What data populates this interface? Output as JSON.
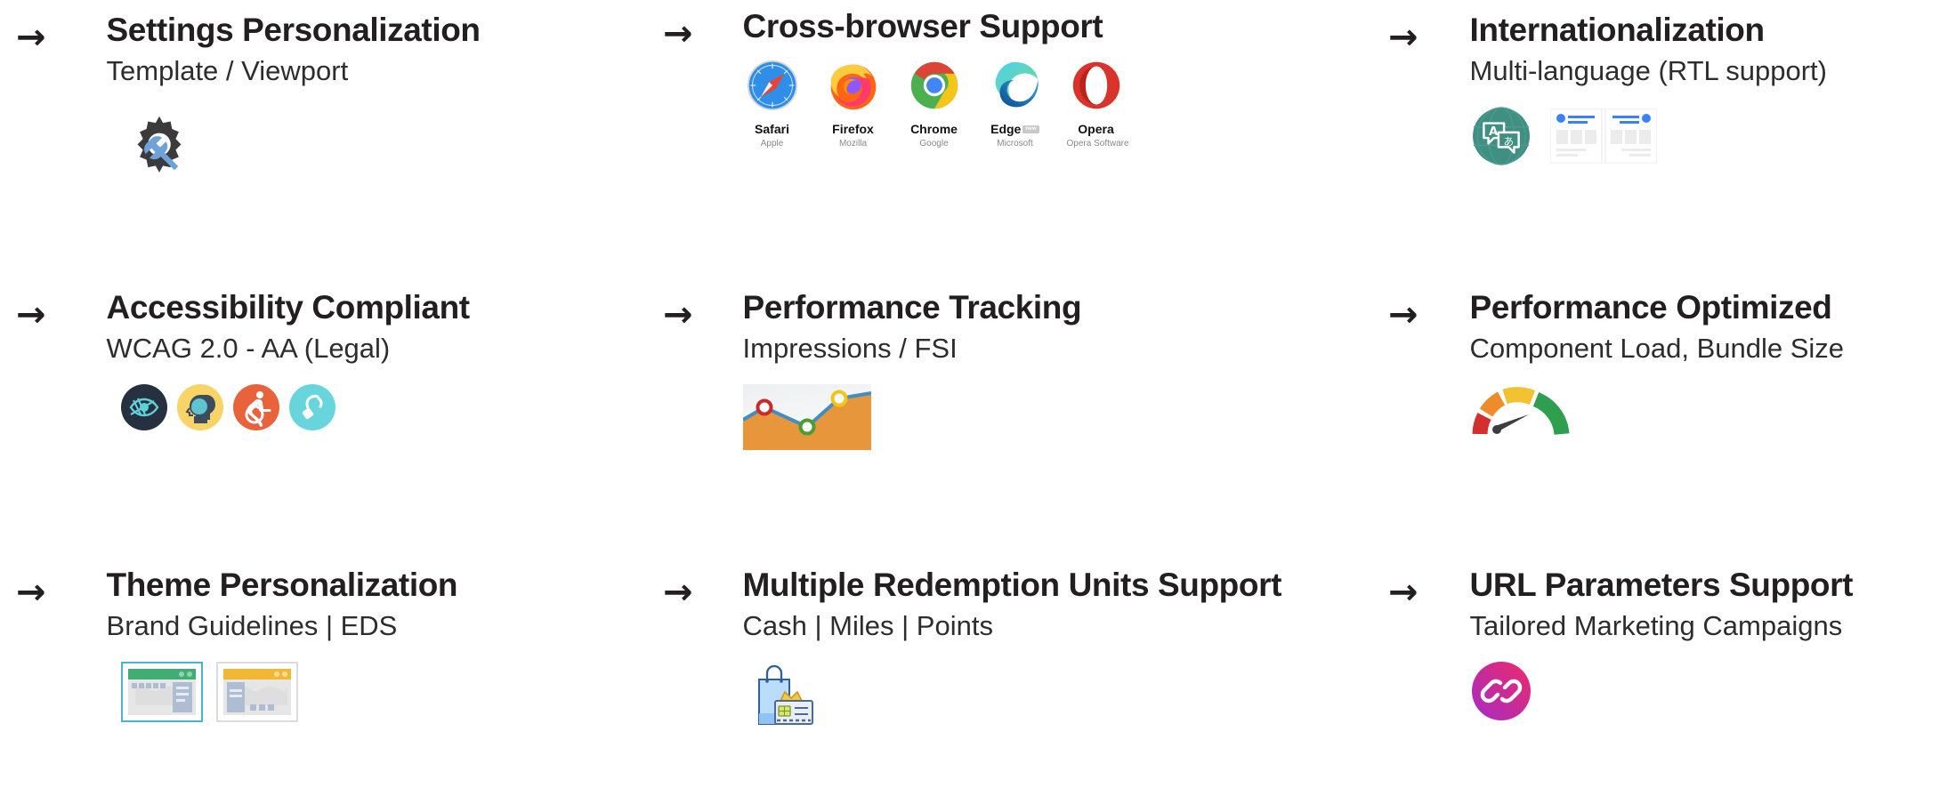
{
  "arrow_glyph": "→",
  "cells": [
    {
      "id": "settings-personalization",
      "title": "Settings Personalization",
      "subtitle": "Template / Viewport",
      "icon": "gear-wrench-icon"
    },
    {
      "id": "cross-browser-support",
      "title": "Cross-browser Support",
      "subtitle": "",
      "browsers": [
        {
          "name": "Safari",
          "vendor": "Apple",
          "icon": "safari-icon",
          "badge": ""
        },
        {
          "name": "Firefox",
          "vendor": "Mozilla",
          "icon": "firefox-icon",
          "badge": ""
        },
        {
          "name": "Chrome",
          "vendor": "Google",
          "icon": "chrome-icon",
          "badge": ""
        },
        {
          "name": "Edge",
          "vendor": "Microsoft",
          "icon": "edge-icon",
          "badge": "new"
        },
        {
          "name": "Opera",
          "vendor": "Opera Software",
          "icon": "opera-icon",
          "badge": ""
        }
      ]
    },
    {
      "id": "internationalization",
      "title": "Internationalization",
      "subtitle": "Multi-language (RTL support)",
      "icon": "translate-icon",
      "mockup": "ltr-rtl-layout-mockup"
    },
    {
      "id": "accessibility-compliant",
      "title": "Accessibility Compliant",
      "subtitle": "WCAG 2.0 - AA (Legal)",
      "a11y_icons": [
        {
          "name": "low-vision-icon",
          "bg": "#27303f",
          "fg": "#5fd0d8"
        },
        {
          "name": "cognitive-icon",
          "bg": "#f7d368",
          "fg": "#3d4b5c"
        },
        {
          "name": "wheelchair-icon",
          "bg": "#e8633c",
          "fg": "#ffffff"
        },
        {
          "name": "hearing-icon",
          "bg": "#68d5dd",
          "fg": "#ffffff"
        }
      ]
    },
    {
      "id": "performance-tracking",
      "title": "Performance Tracking",
      "subtitle": "Impressions / FSI",
      "icon": "area-chart-icon"
    },
    {
      "id": "performance-optimized",
      "title": "Performance Optimized",
      "subtitle": "Component Load, Bundle Size",
      "icon": "gauge-icon"
    },
    {
      "id": "theme-personalization",
      "title": "Theme Personalization",
      "subtitle": "Brand Guidelines | EDS",
      "themes": [
        {
          "name": "theme-thumbnail-green",
          "accent": "#41ac74",
          "selected": true
        },
        {
          "name": "theme-thumbnail-yellow",
          "accent": "#f2b733",
          "selected": false
        }
      ]
    },
    {
      "id": "multiple-redemption-units-support",
      "title": "Multiple Redemption Units Support",
      "subtitle": "Cash | Miles | Points",
      "icon": "shopping-bag-loyalty-card-icon"
    },
    {
      "id": "url-parameters-support",
      "title": "URL Parameters Support",
      "subtitle": "Tailored Marketing Campaigns",
      "icon": "link-icon"
    }
  ],
  "colors": {
    "text": "#231f20",
    "subtext": "#2d2d2d",
    "teal": "#3f8f82",
    "selected_border": "#49b3d3",
    "link_gradient_from": "#a42cc4",
    "link_gradient_to": "#ee2a6b"
  }
}
